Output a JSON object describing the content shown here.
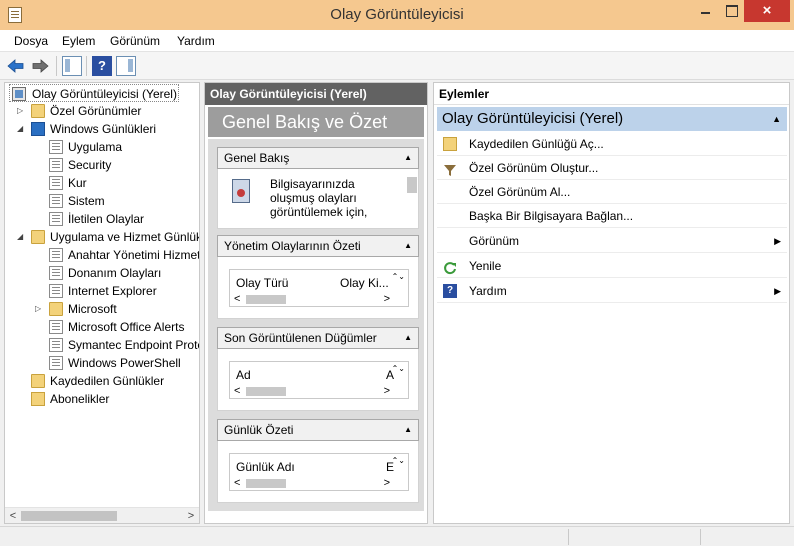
{
  "window": {
    "title": "Olay Görüntüleyicisi",
    "close_glyph": "×"
  },
  "menu": {
    "items": [
      "Dosya",
      "Eylem",
      "Görünüm",
      "Yardım"
    ]
  },
  "toolbar": {
    "help_glyph": "?"
  },
  "tree": {
    "items": [
      {
        "label": "Olay Görüntüleyicisi (Yerel)",
        "icon": "event-viewer-icon",
        "expander": ""
      },
      {
        "label": "Özel Görünümler",
        "icon": "folder-icon",
        "expander": "▷"
      },
      {
        "label": "Windows Günlükleri",
        "icon": "windows-logs-icon",
        "expander": "◢"
      },
      {
        "label": "Uygulama",
        "icon": "log-icon",
        "expander": ""
      },
      {
        "label": "Security",
        "icon": "log-icon",
        "expander": ""
      },
      {
        "label": "Kur",
        "icon": "log-icon",
        "expander": ""
      },
      {
        "label": "Sistem",
        "icon": "log-icon",
        "expander": ""
      },
      {
        "label": "İletilen Olaylar",
        "icon": "log-icon",
        "expander": ""
      },
      {
        "label": "Uygulama ve Hizmet Günlükleri",
        "icon": "folder-icon",
        "expander": "◢"
      },
      {
        "label": "Anahtar Yönetimi Hizmeti",
        "icon": "log-icon",
        "expander": ""
      },
      {
        "label": "Donanım Olayları",
        "icon": "log-icon",
        "expander": ""
      },
      {
        "label": "Internet Explorer",
        "icon": "log-icon",
        "expander": ""
      },
      {
        "label": "Microsoft",
        "icon": "folder-icon",
        "expander": "▷"
      },
      {
        "label": "Microsoft Office Alerts",
        "icon": "log-icon",
        "expander": ""
      },
      {
        "label": "Symantec Endpoint Protection",
        "icon": "log-icon",
        "expander": ""
      },
      {
        "label": "Windows PowerShell",
        "icon": "log-icon",
        "expander": ""
      },
      {
        "label": "Kaydedilen Günlükler",
        "icon": "folder-icon",
        "expander": ""
      },
      {
        "label": "Abonelikler",
        "icon": "subscriptions-icon",
        "expander": ""
      }
    ],
    "scroll_left": "<",
    "scroll_right": ">"
  },
  "middle": {
    "header": "Olay Görüntüleyicisi (Yerel)",
    "title": "Genel Bakış ve Özet",
    "overview": {
      "heading": "Genel Bakış",
      "text": "Bilgisayarınızda oluşmuş olayları görüntülemek için,"
    },
    "admin_summary": {
      "heading": "Yönetim Olaylarının Özeti",
      "col1": "Olay Türü",
      "col2": "Olay Ki..."
    },
    "recent_nodes": {
      "heading": "Son Görüntülenen Düğümler",
      "col1": "Ad",
      "col2": "A"
    },
    "log_summary": {
      "heading": "Günlük Özeti",
      "col1": "Günlük Adı",
      "col2": "E"
    },
    "collapse_glyph": "▲",
    "spin_glyph": "⌃⌄",
    "scroll_left": "<",
    "scroll_right": ">"
  },
  "actions": {
    "header": "Eylemler",
    "group": "Olay Görüntüleyicisi (Yerel)",
    "group_glyph": "▲",
    "submenu_glyph": "▶",
    "items": [
      {
        "label": "Kaydedilen Günlüğü Aç...",
        "icon": "open-log-icon"
      },
      {
        "label": "Özel Görünüm Oluştur...",
        "icon": "filter-icon"
      },
      {
        "label": "Özel Görünüm Al...",
        "icon": ""
      },
      {
        "label": "Başka Bir Bilgisayara Bağlan...",
        "icon": ""
      },
      {
        "label": "Görünüm",
        "icon": ""
      },
      {
        "label": "Yenile",
        "icon": "refresh-icon"
      },
      {
        "label": "Yardım",
        "icon": "help-icon"
      }
    ]
  },
  "colors": {
    "titlebar": "#f5c88f",
    "close_button": "#c7372f",
    "middle_header": "#626262",
    "actions_group": "#bcd2ea"
  }
}
